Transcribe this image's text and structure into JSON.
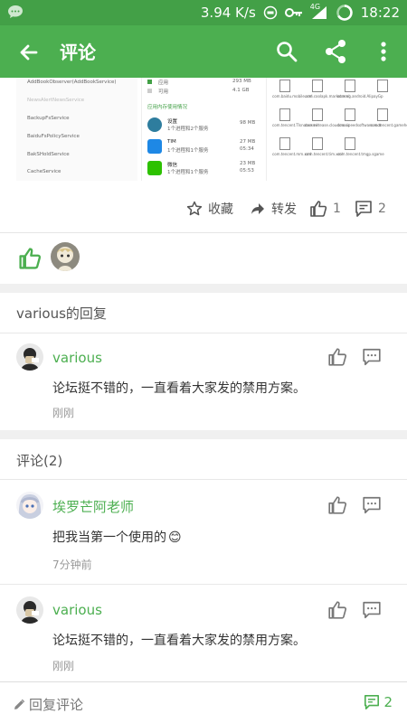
{
  "status_bar": {
    "net_speed": "3.94 K/s",
    "signal_label": "4G",
    "time": "18:22"
  },
  "app_bar": {
    "title": "评论"
  },
  "post_image": {
    "left_items": [
      "AddBookObserver(AddBookService)",
      "NewsAlertNewsService",
      "BackupFsService",
      "BaiduFsPolicyService",
      "BakSHoldService",
      "CacheService"
    ],
    "mid_rows": [
      {
        "label": "应用",
        "value": "293 MB"
      },
      {
        "label": "可用",
        "value": "4.1 GB"
      }
    ],
    "mid_section": "应用内存使用情况",
    "apps": [
      {
        "name": "设置",
        "detail": "1个进程和2个服务",
        "size": "98 MB"
      },
      {
        "name": "TIM",
        "detail": "1个进程和1个服务",
        "size": "27 MB",
        "time": "05:34"
      },
      {
        "name": "微信",
        "detail": "1个进程和1个服务",
        "size": "23 MB",
        "time": "05:53"
      }
    ],
    "files": [
      "com.baidu.mobile.xml",
      "com.coolapk.market.xml",
      "com.eg.android.AlipayGp",
      "com.tencent.TIsnote.xml",
      "com.netease.cloudmusic",
      "com.speedsoftware.root",
      "com.tencent.gamehelper.s",
      "com.tencent.mm.xml",
      "com.tencent.tim.xml",
      "com.tencent.tmgp.sgame"
    ]
  },
  "actions": {
    "favorite": "收藏",
    "forward": "转发",
    "like_count": "1",
    "comment_count": "2"
  },
  "reply_section": {
    "header": "various的回复",
    "comment": {
      "user": "various",
      "text": "论坛挺不错的，一直看着大家发的禁用方案。",
      "time": "刚刚"
    }
  },
  "comments_section": {
    "header": "评论(2)",
    "comments": [
      {
        "user": "埃罗芒阿老师",
        "text": "把我当第一个使用的",
        "emoji": "😊",
        "time": "7分钟前"
      },
      {
        "user": "various",
        "text": "论坛挺不错的，一直看着大家发的禁用方案。",
        "time": "刚刚"
      }
    ]
  },
  "bottom_bar": {
    "reply_label": "回复评论",
    "comment_count": "2"
  },
  "colors": {
    "primary": "#4caf50",
    "status_bar": "#43a047"
  }
}
